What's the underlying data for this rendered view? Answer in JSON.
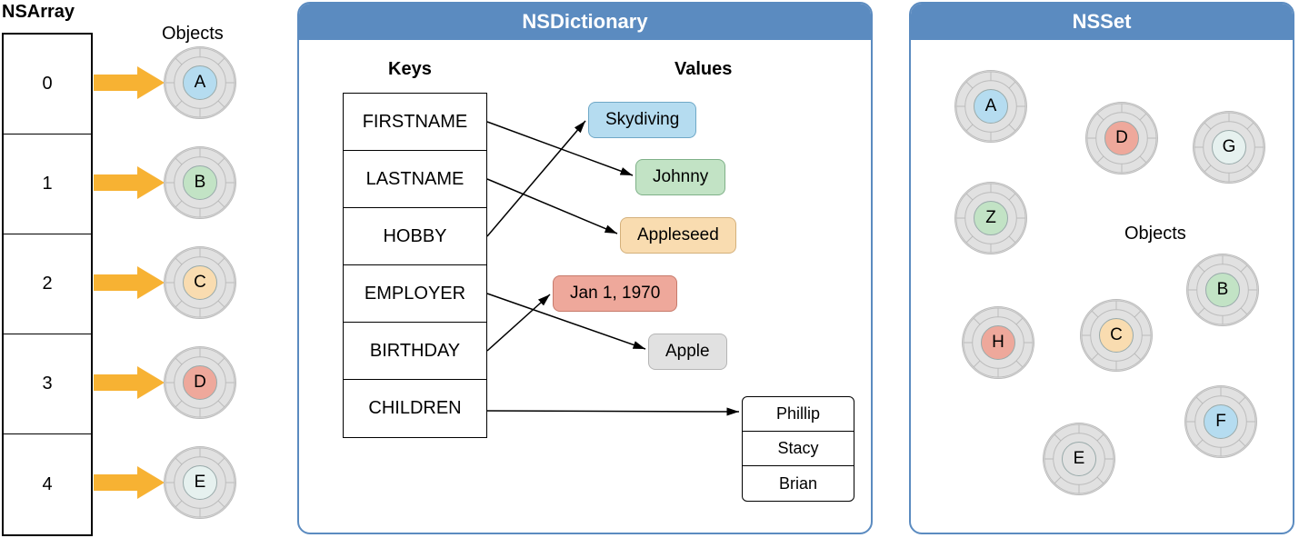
{
  "nsarray": {
    "title": "NSArray",
    "objects_label": "Objects",
    "items": [
      {
        "index": "0",
        "letter": "A",
        "color": "blue"
      },
      {
        "index": "1",
        "letter": "B",
        "color": "green"
      },
      {
        "index": "2",
        "letter": "C",
        "color": "peach"
      },
      {
        "index": "3",
        "letter": "D",
        "color": "red"
      },
      {
        "index": "4",
        "letter": "E",
        "color": "lt"
      }
    ]
  },
  "nsdictionary": {
    "title": "NSDictionary",
    "keys_label": "Keys",
    "values_label": "Values",
    "keys": [
      "FIRSTNAME",
      "LASTNAME",
      "HOBBY",
      "EMPLOYER",
      "BIRTHDAY",
      "CHILDREN"
    ],
    "values": {
      "skydiving": "Skydiving",
      "johnny": "Johnny",
      "appleseed": "Appleseed",
      "jan": "Jan 1, 1970",
      "apple": "Apple"
    },
    "children": [
      "Phillip",
      "Stacy",
      "Brian"
    ],
    "mappings": [
      {
        "key": "FIRSTNAME",
        "value": "Johnny"
      },
      {
        "key": "LASTNAME",
        "value": "Appleseed"
      },
      {
        "key": "HOBBY",
        "value": "Skydiving"
      },
      {
        "key": "EMPLOYER",
        "value": "Apple"
      },
      {
        "key": "BIRTHDAY",
        "value": "Jan 1, 1970"
      },
      {
        "key": "CHILDREN",
        "value": [
          "Phillip",
          "Stacy",
          "Brian"
        ]
      }
    ]
  },
  "nsset": {
    "title": "NSSet",
    "objects_label": "Objects",
    "items": [
      {
        "letter": "A",
        "color": "blue"
      },
      {
        "letter": "D",
        "color": "red"
      },
      {
        "letter": "G",
        "color": "lt"
      },
      {
        "letter": "Z",
        "color": "green"
      },
      {
        "letter": "B",
        "color": "green"
      },
      {
        "letter": "H",
        "color": "red"
      },
      {
        "letter": "C",
        "color": "peach"
      },
      {
        "letter": "F",
        "color": "blue"
      },
      {
        "letter": "E",
        "color": "grey"
      }
    ]
  }
}
